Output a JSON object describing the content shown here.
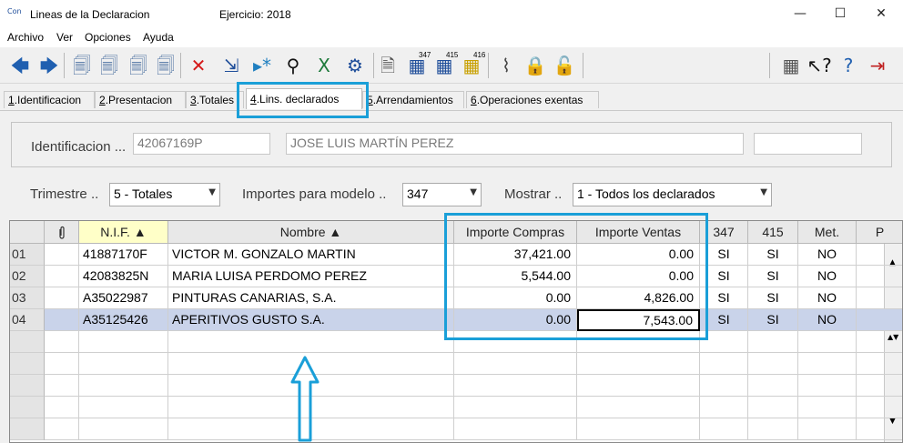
{
  "window": {
    "icon_label": "Con",
    "title": "Lineas de la Declaracion",
    "exercise": "Ejercicio: 2018",
    "controls": {
      "minimize": "—",
      "maximize": "☐",
      "close": "✕"
    }
  },
  "menu": [
    "Archivo",
    "Ver",
    "Opciones",
    "Ayuda"
  ],
  "toolbar": [
    {
      "icon": "arrow-left-icon",
      "glyph": "🡄",
      "color": "#1f5fb0"
    },
    {
      "icon": "arrow-right-icon",
      "glyph": "🡆",
      "color": "#1f5fb0"
    },
    {
      "icon": "document-icon",
      "glyph": "🗐",
      "color": "#4a6fa0"
    },
    {
      "icon": "document-copy-icon",
      "glyph": "🗐",
      "color": "#4a6fa0"
    },
    {
      "icon": "document-edit-icon",
      "glyph": "🗐",
      "color": "#4a6fa0"
    },
    {
      "icon": "document-new-icon",
      "glyph": "🗐",
      "color": "#4a6fa0"
    },
    {
      "icon": "delete-icon",
      "glyph": "✕",
      "color": "#d51a1a"
    },
    {
      "icon": "import-icon",
      "glyph": "⇲",
      "color": "#1f4e9a"
    },
    {
      "icon": "play-star-icon",
      "glyph": "▸*",
      "color": "#1f7fc0"
    },
    {
      "icon": "binoculars-icon",
      "glyph": "⚲",
      "color": "#111"
    },
    {
      "icon": "excel-icon",
      "glyph": "X",
      "color": "#1e7a3b"
    },
    {
      "icon": "settings-icon",
      "glyph": "⚙",
      "color": "#1f4e9a"
    },
    {
      "icon": "report-icon",
      "glyph": "🗎",
      "color": "#555"
    },
    {
      "icon": "model-347-icon",
      "glyph": "▦",
      "color": "#1f4e9a",
      "badge": "347"
    },
    {
      "icon": "model-415-icon",
      "glyph": "▦",
      "color": "#1f4e9a",
      "badge": "415"
    },
    {
      "icon": "model-416-icon",
      "glyph": "▦",
      "color": "#c8a000",
      "badge": "416"
    },
    {
      "icon": "paperclip-icon",
      "glyph": "⌇",
      "color": "#444"
    },
    {
      "icon": "lock-icon",
      "glyph": "🔒",
      "color": "#c8a000"
    },
    {
      "icon": "unlock-icon",
      "glyph": "🔓",
      "color": "#c8a000"
    },
    {
      "icon": "calculator-icon",
      "glyph": "▦",
      "color": "#555"
    },
    {
      "icon": "help-pointer-icon",
      "glyph": "↖?",
      "color": "#111"
    },
    {
      "icon": "help-icon",
      "glyph": "?",
      "color": "#1f5fb0"
    },
    {
      "icon": "exit-icon",
      "glyph": "⇥",
      "color": "#c02020"
    }
  ],
  "tabs": [
    {
      "key": "1",
      "label": ".Identificacion"
    },
    {
      "key": "2",
      "label": ".Presentacion"
    },
    {
      "key": "3",
      "label": ".Totales"
    },
    {
      "key": "4",
      "label": ".Lins. declarados",
      "active": true
    },
    {
      "key": "5",
      "label": ".Arrendamientos"
    },
    {
      "key": "6",
      "label": ".Operaciones exentas"
    }
  ],
  "ident": {
    "label": "Identificacion ...",
    "nif": "42067169P",
    "name": "JOSE LUIS MARTÍN  PEREZ",
    "extra": ""
  },
  "filters": {
    "trimestre_label": "Trimestre ..",
    "trimestre_value": "5 - Totales",
    "importes_label": "Importes para modelo ..",
    "importes_value": "347",
    "mostrar_label": "Mostrar ..",
    "mostrar_value": "1 - Todos los declarados"
  },
  "grid": {
    "columns": [
      "",
      "",
      "N.I.F.  ▲",
      "Nombre  ▲",
      "Importe Compras",
      "Importe Ventas",
      "347",
      "415",
      "Met.",
      "P"
    ],
    "rows": [
      {
        "id": "01",
        "nif": "41887170F",
        "nombre": "VICTOR M. GONZALO MARTIN",
        "compras": "37,421.00",
        "ventas": "0.00",
        "c347": "SI",
        "c415": "SI",
        "met": "NO"
      },
      {
        "id": "02",
        "nif": "42083825N",
        "nombre": "MARIA LUISA PERDOMO PEREZ",
        "compras": "5,544.00",
        "ventas": "0.00",
        "c347": "SI",
        "c415": "SI",
        "met": "NO"
      },
      {
        "id": "03",
        "nif": "A35022987",
        "nombre": "PINTURAS CANARIAS, S.A.",
        "compras": "0.00",
        "ventas": "4,826.00",
        "c347": "SI",
        "c415": "SI",
        "met": "NO"
      },
      {
        "id": "04",
        "nif": "A35125426",
        "nombre": "APERITIVOS GUSTO S.A.",
        "compras": "0.00",
        "ventas": "7,543.00",
        "c347": "SI",
        "c415": "SI",
        "met": "NO"
      }
    ],
    "scroll": {
      "up": "▲",
      "mid": "▲▼",
      "down": "▼"
    }
  },
  "colors": {
    "annotation": "#1a9fd8",
    "selected_row": "#c9d3ea"
  }
}
